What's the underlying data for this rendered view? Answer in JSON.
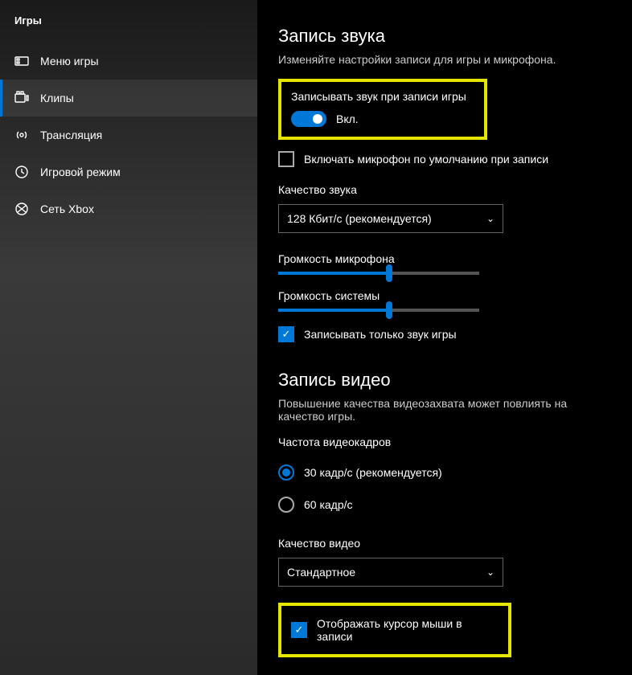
{
  "sidebar": {
    "title": "Игры",
    "items": [
      {
        "label": "Меню игры"
      },
      {
        "label": "Клипы"
      },
      {
        "label": "Трансляция"
      },
      {
        "label": "Игровой режим"
      },
      {
        "label": "Сеть Xbox"
      }
    ]
  },
  "audio": {
    "title": "Запись звука",
    "desc": "Изменяйте настройки записи для игры и микрофона.",
    "record_audio_label": "Записывать звук при записи игры",
    "toggle_state": "Вкл.",
    "mic_default_label": "Включать микрофон по умолчанию при записи",
    "quality_label": "Качество звука",
    "quality_value": "128 Кбит/с (рекомендуется)",
    "mic_vol_label": "Громкость микрофона",
    "sys_vol_label": "Громкость системы",
    "game_only_label": "Записывать только звук игры"
  },
  "video": {
    "title": "Запись видео",
    "desc": "Повышение качества видеозахвата может повлиять на качество игры.",
    "fps_label": "Частота видеокадров",
    "fps30": "30 кадр/с (рекомендуется)",
    "fps60": "60 кадр/с",
    "quality_label": "Качество видео",
    "quality_value": "Стандартное",
    "cursor_label": "Отображать курсор мыши в записи"
  }
}
